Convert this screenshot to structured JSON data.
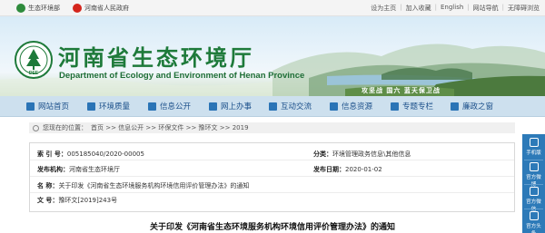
{
  "topbar": {
    "links": [
      {
        "label": "生态环境部"
      },
      {
        "label": "河南省人民政府"
      }
    ],
    "right": [
      "设为主页",
      "加入收藏",
      "English",
      "网站导航",
      "无障碍浏览"
    ]
  },
  "banner": {
    "title_cn": "河南省生态环境厅",
    "title_en": "Department of Ecology and Environment of Henan Province",
    "slogan": "攻坚战  国六  蓝天保卫战",
    "logo_text": "DEE"
  },
  "nav": {
    "items": [
      {
        "label": "网站首页"
      },
      {
        "label": "环境质量"
      },
      {
        "label": "信息公开"
      },
      {
        "label": "网上办事"
      },
      {
        "label": "互动交流"
      },
      {
        "label": "信息资源"
      },
      {
        "label": "专题专栏"
      },
      {
        "label": "廉政之窗"
      }
    ]
  },
  "breadcrumb": {
    "prefix": "您现在的位置：",
    "path": "首页 >> 信息公开 >> 环保文件 >> 豫环文 >> 2019"
  },
  "info": {
    "index_key": "索 引 号：",
    "index_val": "005185040/2020-00005",
    "category_key": "分类：",
    "category_val": "环境管理政务信息\\其他信息",
    "publisher_key": "发布机构：",
    "publisher_val": "河南省生态环境厅",
    "date_key": "发布日期：",
    "date_val": "2020-01-02",
    "name_key": "名    称：",
    "name_val": "关于印发《河南省生态环境服务机构环境信用评价管理办法》的通知",
    "docno_key": "文    号：",
    "docno_val": "豫环文[2019]243号"
  },
  "document": {
    "title": "关于印发《河南省生态环境服务机构环境信用评价管理办法》的通知"
  },
  "sidebar": {
    "items": [
      {
        "label": "手机版"
      },
      {
        "label": "官方微博"
      },
      {
        "label": "官方微信"
      },
      {
        "label": "官方头条"
      }
    ]
  },
  "colors": {
    "brand_green": "#1e7a3a",
    "nav_bg": "#cde0ee",
    "nav_text": "#1b4f8a",
    "sidebar_blue": "#2d7ab8"
  }
}
